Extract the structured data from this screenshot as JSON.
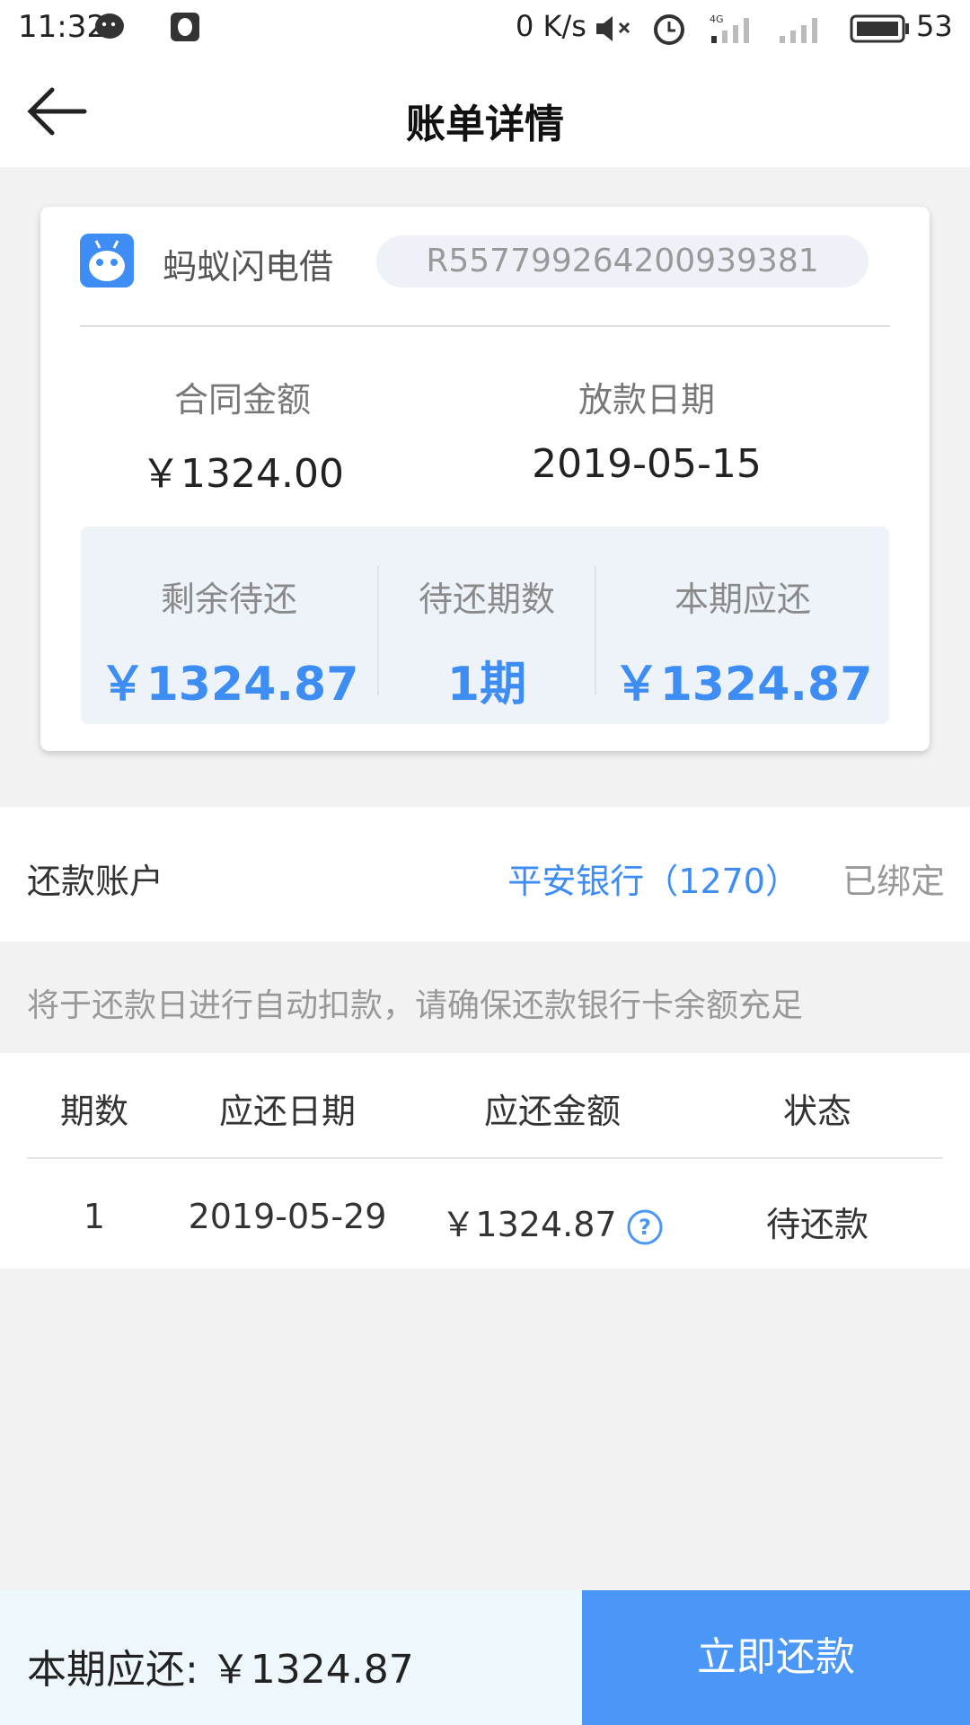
{
  "status_bar": {
    "time": "11:32",
    "net_speed": "0 K/s",
    "battery_percent": "53",
    "icons": [
      "wechat-icon",
      "qq-icon",
      "mute-icon",
      "alarm-icon",
      "signal-4g-icon",
      "signal-icon",
      "battery-icon"
    ]
  },
  "header": {
    "title": "账单详情",
    "back_icon": "back-arrow-icon"
  },
  "loan_card": {
    "product_name": "蚂蚁闪电借",
    "contract_no": "R557799264200939381",
    "contract_amount_label": "合同金额",
    "contract_amount_value": "￥1324.00",
    "loan_date_label": "放款日期",
    "loan_date_value": "2019-05-15",
    "summary": {
      "remaining_label": "剩余待还",
      "remaining_value": "￥1324.87",
      "periods_label": "待还期数",
      "periods_value": "1期",
      "current_label": "本期应还",
      "current_value": "￥1324.87"
    }
  },
  "repay_account": {
    "label": "还款账户",
    "bank": "平安银行（1270）",
    "status": "已绑定"
  },
  "notice": "将于还款日进行自动扣款，请确保还款银行卡余额充足",
  "schedule": {
    "headers": [
      "期数",
      "应还日期",
      "应还金额",
      "状态"
    ],
    "rows": [
      {
        "period": "1",
        "date": "2019-05-29",
        "amount": "￥1324.87",
        "status": "待还款"
      }
    ]
  },
  "bottom_bar": {
    "due_text": "本期应还: ￥1324.87",
    "pay_button": "立即还款"
  },
  "colors": {
    "accent": "#3d8df5",
    "pay_button": "#4b97f7",
    "background": "#f2f2f2"
  }
}
